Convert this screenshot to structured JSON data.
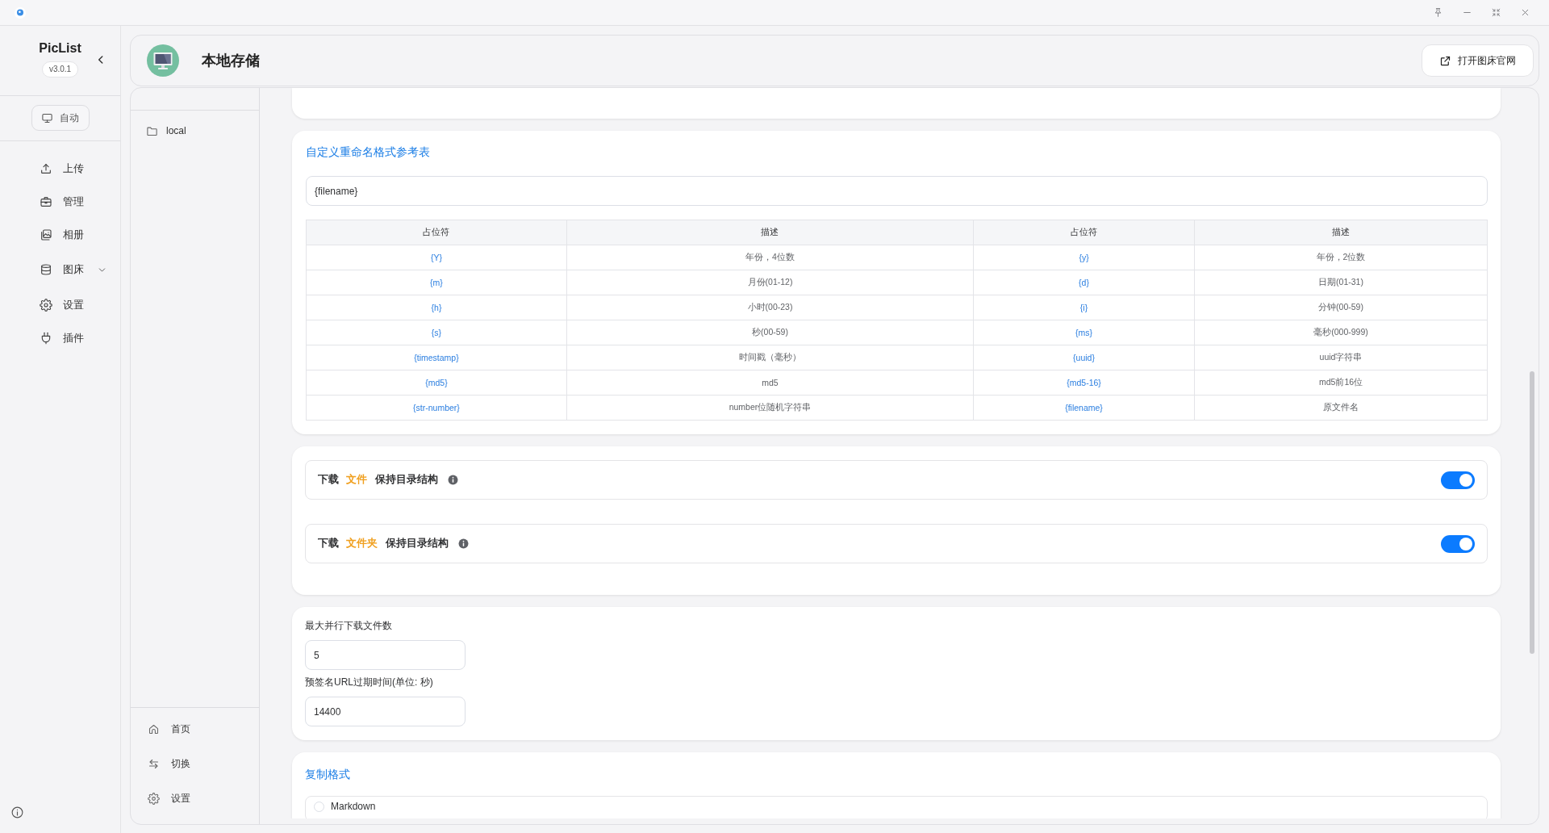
{
  "sidebar": {
    "app_name": "PicList",
    "version": "v3.0.1",
    "theme_button": {
      "label": "自动"
    },
    "items": [
      {
        "label": "上传",
        "kind": "link"
      },
      {
        "label": "管理",
        "kind": "link"
      },
      {
        "label": "相册",
        "kind": "link"
      },
      {
        "label": "图床",
        "kind": "group",
        "expanded": false
      },
      {
        "label": "设置",
        "kind": "link"
      },
      {
        "label": "插件",
        "kind": "link"
      }
    ]
  },
  "header": {
    "title": "本地存储",
    "open_button": "打开图床官网"
  },
  "picbed_list": {
    "items": [
      {
        "label": "local"
      }
    ],
    "footer_items": [
      {
        "label": "首页"
      },
      {
        "label": "切换"
      },
      {
        "label": "设置"
      }
    ]
  },
  "rename_card": {
    "title": "自定义重命名格式参考表",
    "input": {
      "value": "{filename}"
    },
    "table": {
      "columns": [
        {
          "label": "占位符",
          "kind": "placeholder"
        },
        {
          "label": "描述",
          "kind": "description"
        },
        {
          "label": "占位符",
          "kind": "placeholder"
        },
        {
          "label": "描述",
          "kind": "description"
        }
      ],
      "rows": [
        [
          "{Y}",
          "年份，4位数",
          "{y}",
          "年份，2位数"
        ],
        [
          "{m}",
          "月份(01-12)",
          "{d}",
          "日期(01-31)"
        ],
        [
          "{h}",
          "小时(00-23)",
          "{i}",
          "分钟(00-59)"
        ],
        [
          "{s}",
          "秒(00-59)",
          "{ms}",
          "毫秒(000-999)"
        ],
        [
          "{timestamp}",
          "时间戳（毫秒）",
          "{uuid}",
          "uuid字符串"
        ],
        [
          "{md5}",
          "md5",
          "{md5-16}",
          "md5前16位"
        ],
        [
          "{str-number}",
          "number位随机字符串",
          "{filename}",
          "原文件名"
        ]
      ]
    }
  },
  "structure_card": {
    "toggles": [
      {
        "parts": [
          {
            "text": "下载",
            "kind": "plain"
          },
          {
            "text": "文件",
            "kind": "accent"
          },
          {
            "text": "保持目录结构",
            "kind": "plain"
          }
        ],
        "on": true
      },
      {
        "parts": [
          {
            "text": "下载",
            "kind": "plain"
          },
          {
            "text": "文件夹",
            "kind": "accent"
          },
          {
            "text": "保持目录结构",
            "kind": "plain"
          }
        ],
        "on": true
      }
    ]
  },
  "download_card": {
    "fields": [
      {
        "label": "最大并行下载文件数",
        "value": "5"
      },
      {
        "label": "预签名URL过期时间(单位: 秒)",
        "value": "14400"
      }
    ]
  },
  "copy_format_card": {
    "title": "复制格式",
    "options": [
      {
        "label": "Markdown",
        "selected": false
      }
    ]
  }
}
